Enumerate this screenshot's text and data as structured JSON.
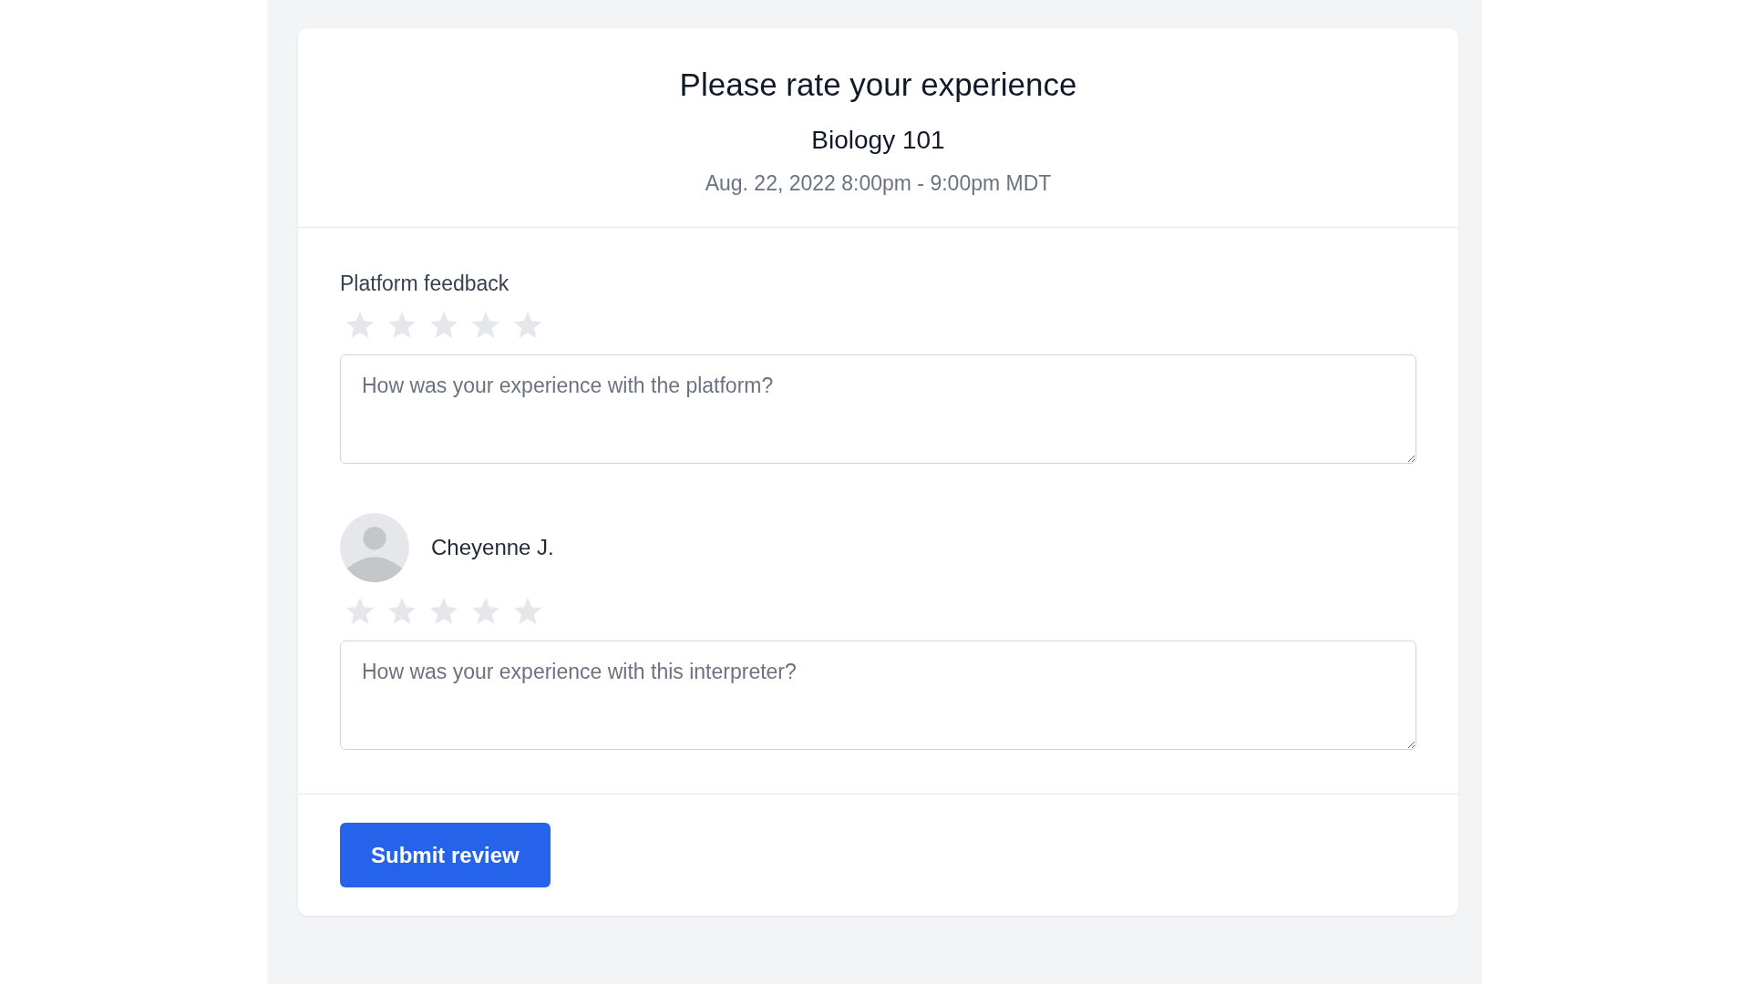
{
  "header": {
    "title": "Please rate your experience",
    "course": "Biology 101",
    "time": "Aug. 22, 2022 8:00pm - 9:00pm MDT"
  },
  "sections": [
    {
      "kind": "platform",
      "label": "Platform feedback",
      "stars": 0,
      "placeholder": "How was your experience with the platform?"
    },
    {
      "kind": "person",
      "name": "Cheyenne J.",
      "stars": 0,
      "placeholder": "How was your experience with this interpreter?"
    }
  ],
  "submit": {
    "label": "Submit review"
  }
}
